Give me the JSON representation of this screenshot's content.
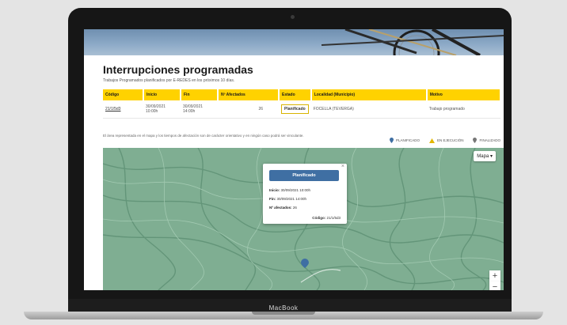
{
  "device": {
    "brand": "MacBook"
  },
  "page": {
    "title": "Interrupciones programadas",
    "subtitle": "Trabajos Programados planificados por E-REDES en los próximos 10 días."
  },
  "table": {
    "headers": [
      "Código",
      "Inicio",
      "Fin",
      "Nº Afectados",
      "Estado",
      "Localidad (Municipio)",
      "Motivo"
    ],
    "rows": [
      {
        "codigo": "21/1/5d3",
        "inicio_date": "30/09/2021",
        "inicio_time": "10:00h",
        "fin_date": "30/09/2021",
        "fin_time": "14:00h",
        "afectados": "26",
        "estado": "Planificado",
        "localidad": "FOCELLA (TEVERGA)",
        "motivo": "Trabajo programado"
      }
    ]
  },
  "map_note": "El área representada en el mapa y los tiempos de afectación son de carácter orientativo y en ningún caso podrá ser vinculante.",
  "legend": [
    {
      "label": "PLANIFICADO",
      "icon": "pin-icon",
      "color": "#3f6fa3"
    },
    {
      "label": "EN EJECUCIÓN",
      "icon": "warning-icon",
      "color": "#e2b600"
    },
    {
      "label": "FINALIZADO",
      "icon": "pin-icon",
      "color": "#777777"
    }
  ],
  "map": {
    "type_label": "Mapa",
    "zoom_in": "+",
    "zoom_out": "−",
    "popup": {
      "button": "Planificado",
      "close": "×",
      "inicio_label": "Inicio:",
      "inicio_value": "30/09/2021 10:00h",
      "fin_label": "Fin:",
      "fin_value": "30/09/2021 14:00h",
      "afectados_label": "Nº afectados:",
      "afectados_value": "26",
      "codigo_label": "Código:",
      "codigo_value": "21/1/5d3"
    }
  },
  "colors": {
    "accent_yellow": "#ffd200",
    "accent_blue": "#3f6fa3",
    "terrain": "#7fae92"
  }
}
